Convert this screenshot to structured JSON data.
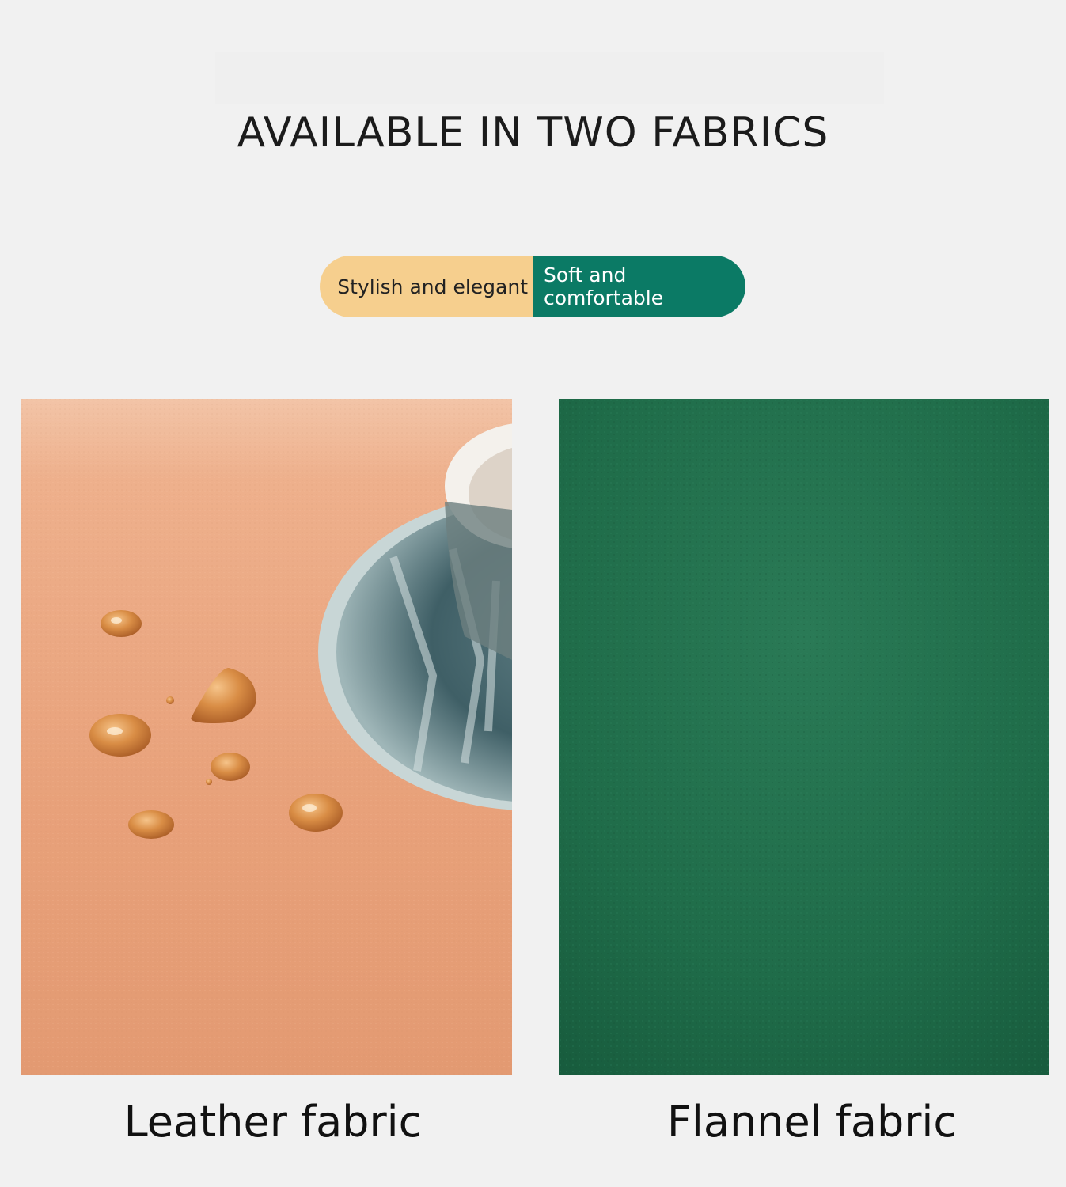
{
  "header": {
    "title": "AVAILABLE IN TWO FABRICS"
  },
  "pill": {
    "left_label": "Stylish and elegant",
    "right_label": "Soft and comfortable"
  },
  "fabrics": [
    {
      "label": "Leather fabric"
    },
    {
      "label": "Flannel fabric"
    }
  ],
  "colors": {
    "background": "#f1f1f1",
    "pill_left": "#f6cf8e",
    "pill_right": "#0b7a65",
    "leather": "#e9a47d",
    "flannel": "#1f6d4a"
  }
}
